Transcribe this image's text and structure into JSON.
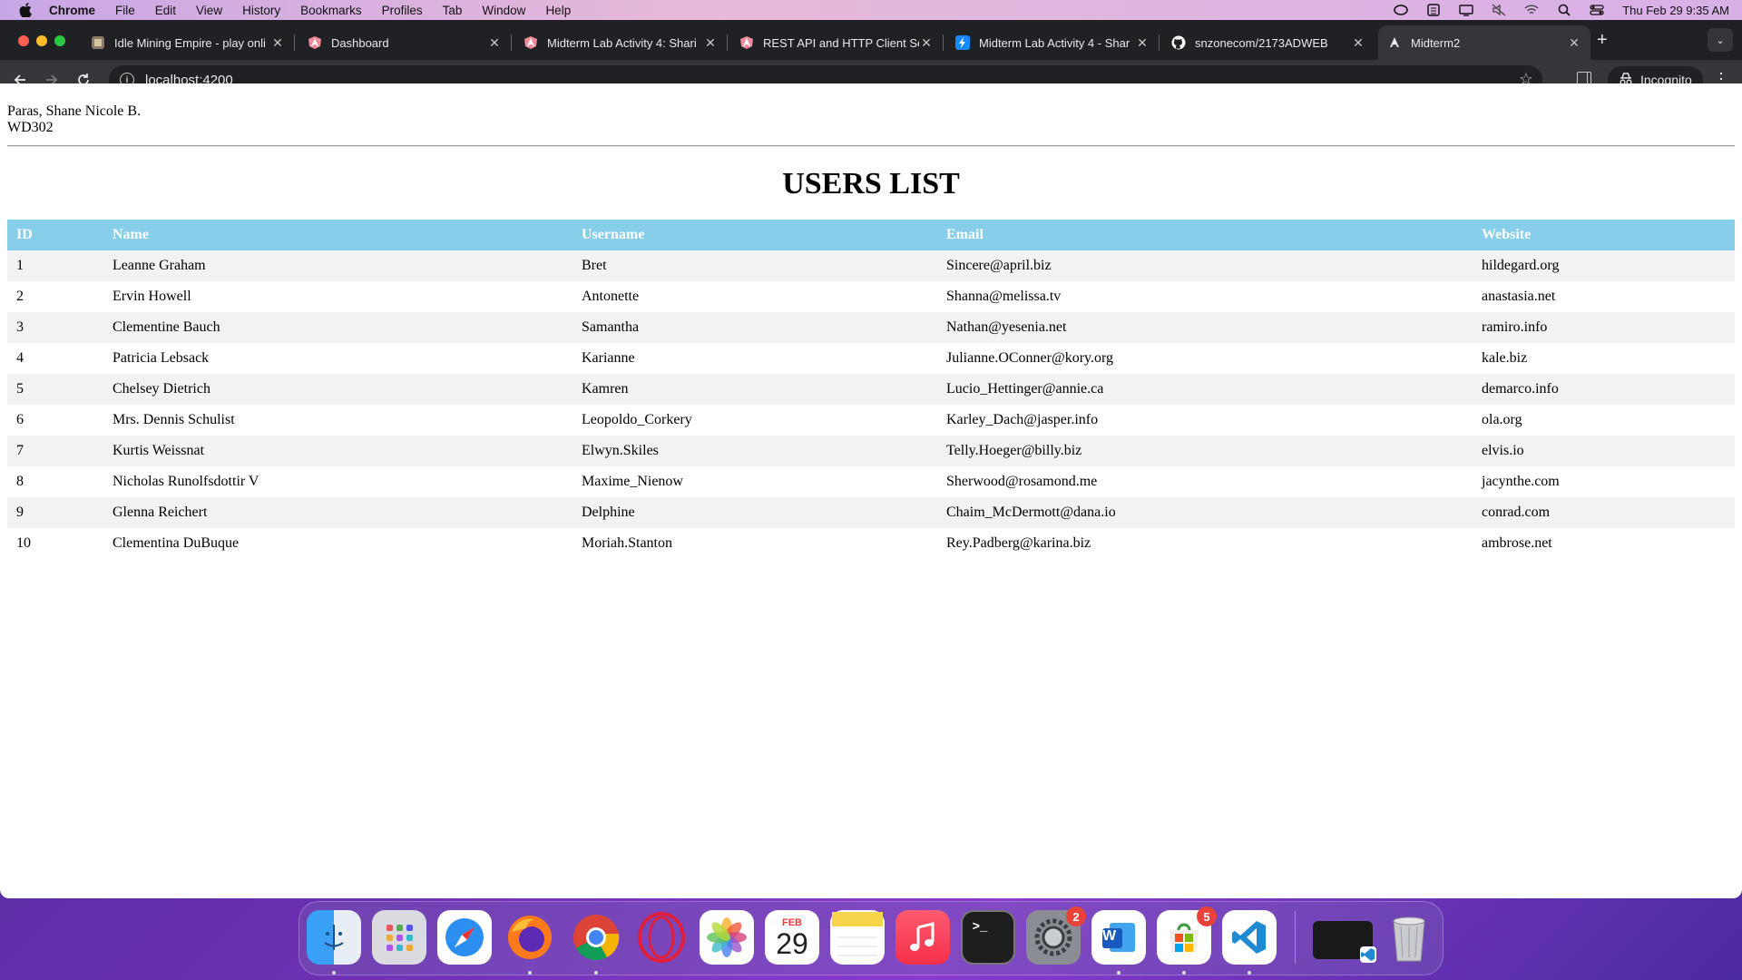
{
  "menubar": {
    "app": "Chrome",
    "items": [
      "File",
      "Edit",
      "View",
      "History",
      "Bookmarks",
      "Profiles",
      "Tab",
      "Window",
      "Help"
    ],
    "clock": "Thu Feb 29  9:35 AM"
  },
  "tabs": [
    {
      "title": "Idle Mining Empire - play onli",
      "favicon": "game-icon"
    },
    {
      "title": "Dashboard",
      "favicon": "angular-icon"
    },
    {
      "title": "Midterm Lab Activity 4: Shari",
      "favicon": "angular-icon"
    },
    {
      "title": "REST API and HTTP Client Se",
      "favicon": "angular-icon"
    },
    {
      "title": "Midterm Lab Activity 4 - Shar",
      "favicon": "stackblitz-icon"
    },
    {
      "title": "snzonecom/2173ADWEB",
      "favicon": "github-icon"
    },
    {
      "title": "Midterm2",
      "favicon": "angular-icon"
    }
  ],
  "address": {
    "url": "localhost:4200"
  },
  "incognito_label": "Incognito",
  "student": {
    "name": "Paras, Shane Nicole B.",
    "section": "WD302"
  },
  "page_title": "USERS LIST",
  "table": {
    "headers": [
      "ID",
      "Name",
      "Username",
      "Email",
      "Website"
    ],
    "rows": [
      [
        "1",
        "Leanne Graham",
        "Bret",
        "Sincere@april.biz",
        "hildegard.org"
      ],
      [
        "2",
        "Ervin Howell",
        "Antonette",
        "Shanna@melissa.tv",
        "anastasia.net"
      ],
      [
        "3",
        "Clementine Bauch",
        "Samantha",
        "Nathan@yesenia.net",
        "ramiro.info"
      ],
      [
        "4",
        "Patricia Lebsack",
        "Karianne",
        "Julianne.OConner@kory.org",
        "kale.biz"
      ],
      [
        "5",
        "Chelsey Dietrich",
        "Kamren",
        "Lucio_Hettinger@annie.ca",
        "demarco.info"
      ],
      [
        "6",
        "Mrs. Dennis Schulist",
        "Leopoldo_Corkery",
        "Karley_Dach@jasper.info",
        "ola.org"
      ],
      [
        "7",
        "Kurtis Weissnat",
        "Elwyn.Skiles",
        "Telly.Hoeger@billy.biz",
        "elvis.io"
      ],
      [
        "8",
        "Nicholas Runolfsdottir V",
        "Maxime_Nienow",
        "Sherwood@rosamond.me",
        "jacynthe.com"
      ],
      [
        "9",
        "Glenna Reichert",
        "Delphine",
        "Chaim_McDermott@dana.io",
        "conrad.com"
      ],
      [
        "10",
        "Clementina DuBuque",
        "Moriah.Stanton",
        "Rey.Padberg@karina.biz",
        "ambrose.net"
      ]
    ]
  },
  "dock": {
    "apps": [
      {
        "name": "finder-icon",
        "badge": ""
      },
      {
        "name": "launchpad-icon",
        "badge": ""
      },
      {
        "name": "safari-icon",
        "badge": ""
      },
      {
        "name": "firefox-icon",
        "badge": ""
      },
      {
        "name": "chrome-icon",
        "badge": ""
      },
      {
        "name": "opera-icon",
        "badge": ""
      },
      {
        "name": "photos-icon",
        "badge": ""
      },
      {
        "name": "calendar-icon",
        "badge": "",
        "month": "FEB",
        "day": "29"
      },
      {
        "name": "notes-icon",
        "badge": ""
      },
      {
        "name": "music-icon",
        "badge": ""
      },
      {
        "name": "terminal-icon",
        "badge": ""
      },
      {
        "name": "system-settings-icon",
        "badge": "2"
      },
      {
        "name": "word-icon",
        "badge": "W"
      },
      {
        "name": "microsoft-store-icon",
        "badge": "5"
      },
      {
        "name": "vscode-icon",
        "badge": ""
      },
      {
        "name": "vscode-window-icon",
        "badge": ""
      },
      {
        "name": "trash-icon",
        "badge": ""
      }
    ]
  },
  "colors": {
    "header_bg": "#87ceeb",
    "row_stripe": "#f2f2f2",
    "tabbar": "#202124",
    "toolbar": "#35363a"
  }
}
